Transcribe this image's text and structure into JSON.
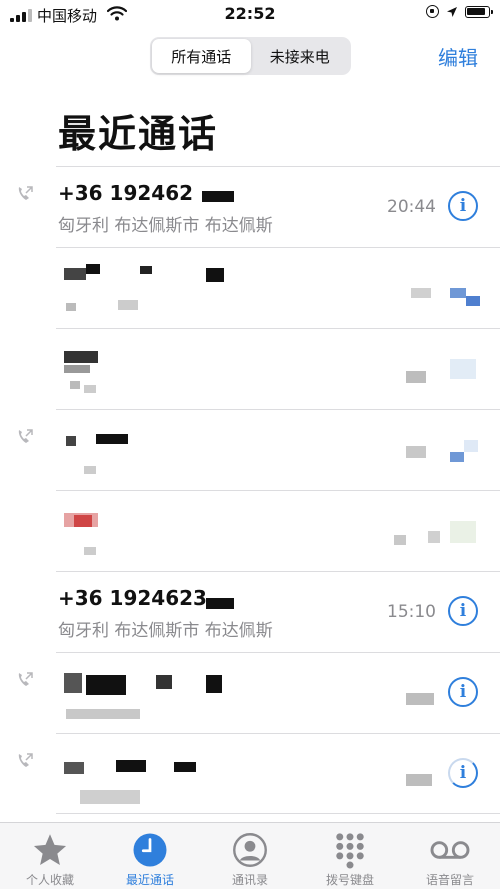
{
  "status_bar": {
    "carrier": "中国移动",
    "time": "22:52"
  },
  "segmented": {
    "all": "所有通话",
    "missed": "未接来电"
  },
  "header": {
    "edit": "编辑",
    "title": "最近通话"
  },
  "calls": [
    {
      "number": "+36 192462",
      "location": "匈牙利 布达佩斯市 布达佩斯",
      "time": "20:44",
      "outgoing": true
    },
    {
      "number": "",
      "location": "",
      "time": "",
      "outgoing": false
    },
    {
      "number": "",
      "location": "",
      "time": "",
      "outgoing": false
    },
    {
      "number": "",
      "location": "",
      "time": "",
      "outgoing": true
    },
    {
      "number": "",
      "location": "",
      "time": "",
      "outgoing": false
    },
    {
      "number": "+36 1924623",
      "location": "匈牙利 布达佩斯市 布达佩斯",
      "time": "15:10",
      "outgoing": false
    },
    {
      "number": "",
      "location": "",
      "time": "",
      "outgoing": true
    },
    {
      "number": "",
      "location": "",
      "time": "",
      "outgoing": true
    }
  ],
  "tabs": [
    {
      "label": "个人收藏",
      "icon": "star-icon"
    },
    {
      "label": "最近通话",
      "icon": "clock-icon",
      "active": true
    },
    {
      "label": "通讯录",
      "icon": "contact-icon"
    },
    {
      "label": "拨号键盘",
      "icon": "keypad-icon"
    },
    {
      "label": "语音留言",
      "icon": "voicemail-icon"
    }
  ],
  "colors": {
    "accent": "#2f7fdc",
    "secondary_text": "#8a8a8e"
  }
}
